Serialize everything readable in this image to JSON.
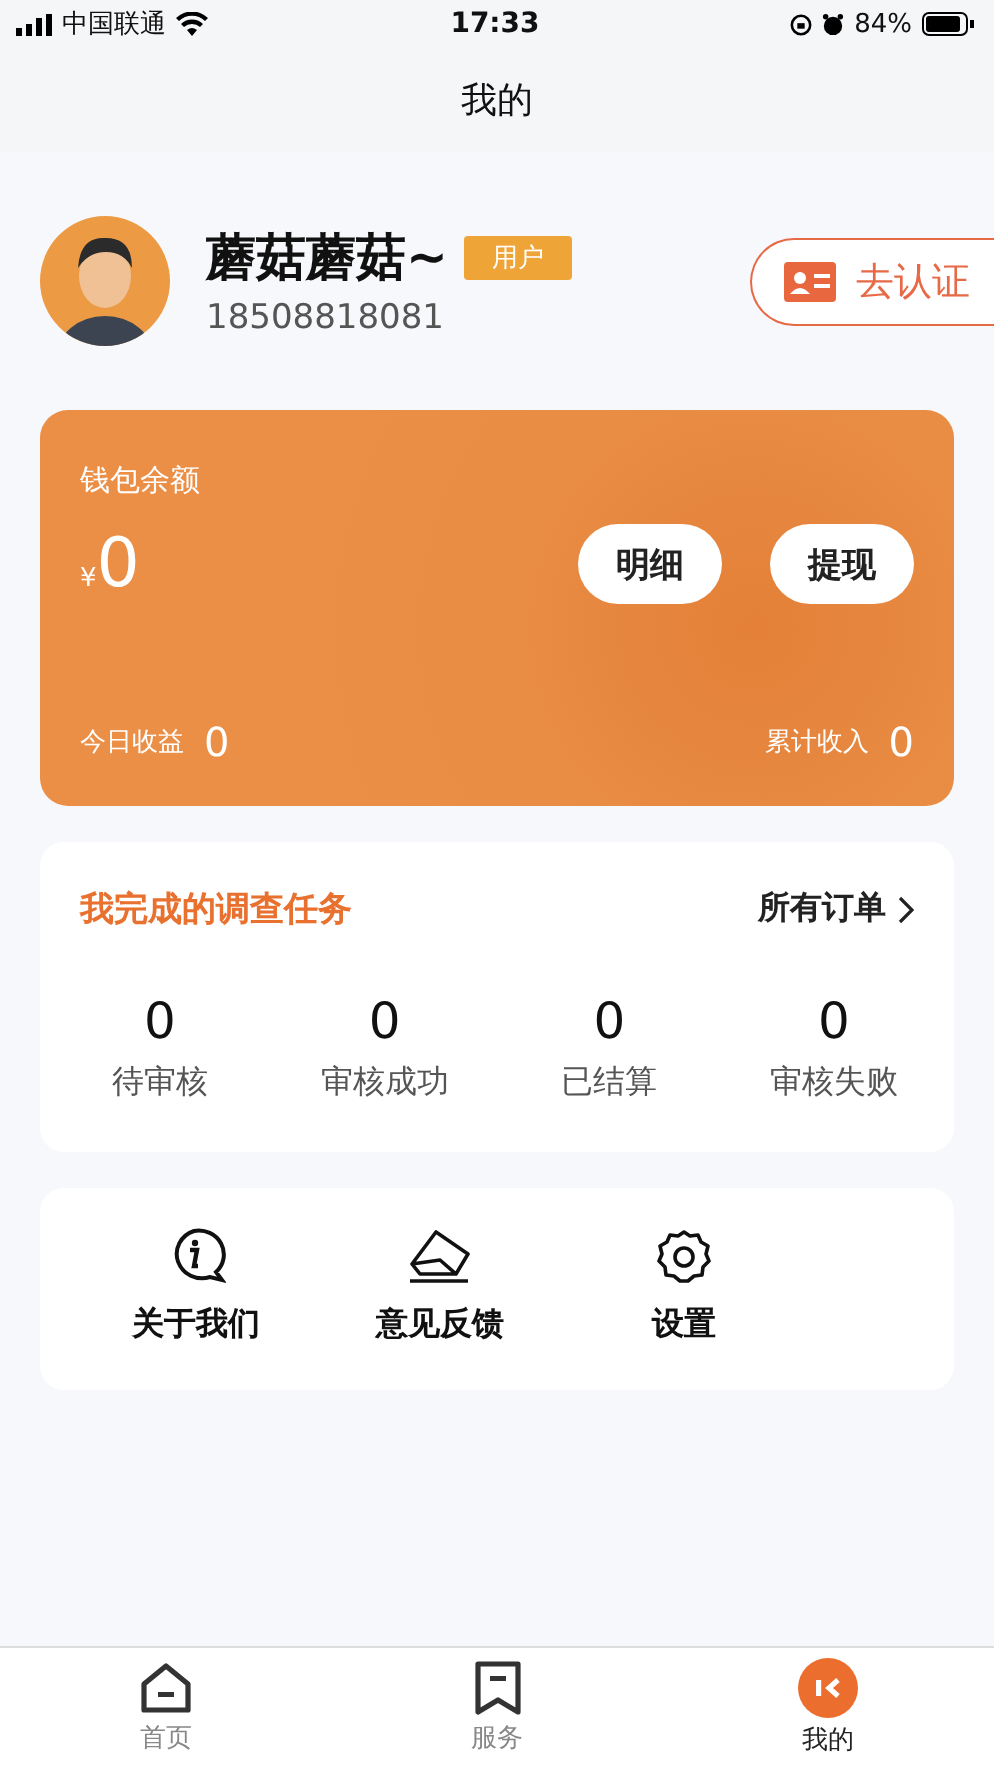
{
  "status_bar": {
    "carrier": "中国联通",
    "time": "17:33",
    "battery": "84%"
  },
  "header": {
    "title": "我的"
  },
  "profile": {
    "name": "蘑菇蘑菇~",
    "badge": "用户",
    "phone": "18508818081",
    "verify_button": "去认证"
  },
  "wallet": {
    "title": "钱包余额",
    "currency": "¥",
    "balance": "0",
    "buttons": [
      "明细",
      "提现"
    ],
    "today_label": "今日收益",
    "today_value": "0",
    "total_label": "累计收入",
    "total_value": "0"
  },
  "tasks": {
    "title": "我完成的调查任务",
    "link": "所有订单",
    "stats": [
      {
        "value": "0",
        "label": "待审核"
      },
      {
        "value": "0",
        "label": "审核成功"
      },
      {
        "value": "0",
        "label": "已结算"
      },
      {
        "value": "0",
        "label": "审核失败"
      }
    ]
  },
  "menu": [
    {
      "kind": "info",
      "label": "关于我们"
    },
    {
      "kind": "feedback",
      "label": "意见反馈"
    },
    {
      "kind": "settings",
      "label": "设置"
    }
  ],
  "tabs": [
    {
      "kind": "home",
      "label": "首页",
      "selected": false
    },
    {
      "kind": "service",
      "label": "服务",
      "selected": false
    },
    {
      "kind": "mine",
      "label": "我的",
      "selected": true
    }
  ]
}
